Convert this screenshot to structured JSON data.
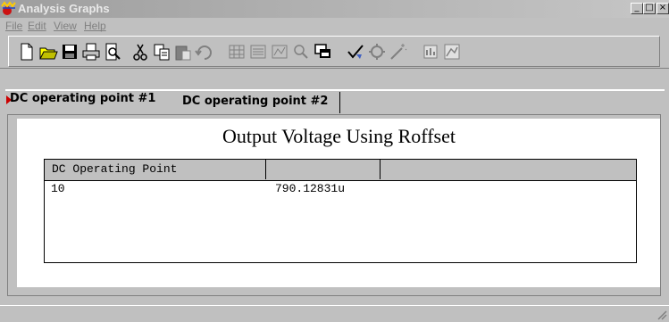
{
  "window": {
    "title": "Analysis Graphs"
  },
  "menu": {
    "items": [
      "File",
      "Edit",
      "View",
      "Help"
    ]
  },
  "toolbar": {
    "buttons": [
      "new-icon",
      "open-icon",
      "save-icon",
      "print-icon",
      "print-preview-icon",
      "cut-icon",
      "copy-icon",
      "paste-icon",
      "undo-icon",
      "grid-icon",
      "list-icon",
      "chart-icon",
      "zoom-icon",
      "window-icon",
      "check-icon",
      "settings-icon",
      "wand-icon",
      "export-icon",
      "graph-icon"
    ]
  },
  "tabs": [
    {
      "label": "DC operating point #1",
      "active": true
    },
    {
      "label": "DC operating point #2",
      "active": false
    }
  ],
  "graph": {
    "title": "Output Voltage Using Roffset",
    "columns": [
      "DC Operating Point",
      "",
      ""
    ],
    "rows": [
      [
        "10",
        "790.12831u",
        ""
      ]
    ]
  },
  "colors": {
    "face": "#c0c0c0",
    "tab_marker": "#cc0000"
  }
}
